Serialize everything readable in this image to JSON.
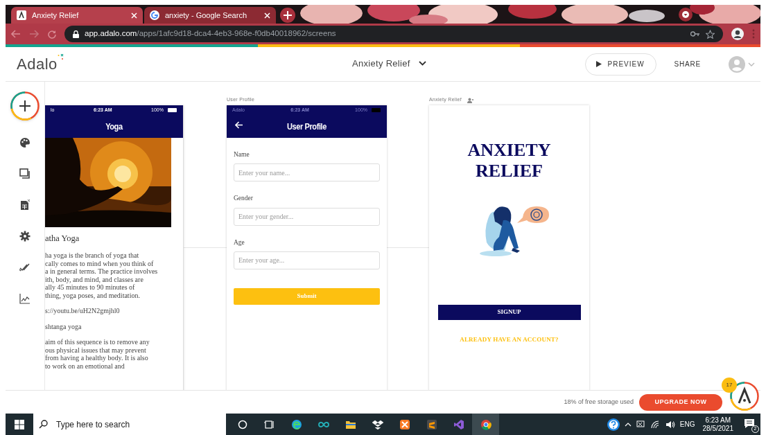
{
  "browser": {
    "tabs": [
      {
        "title": "Anxiety Relief",
        "selected": true
      },
      {
        "title": "anxiety - Google Search",
        "selected": false
      }
    ],
    "url": {
      "host": "app.adalo.com",
      "path": "/apps/1afc9d18-dca4-4eb3-968e-f0db40018962/screens"
    }
  },
  "header": {
    "logo": "Adalo",
    "app_name": "Anxiety Relief",
    "preview": "PREVIEW",
    "share": "SHARE"
  },
  "screens": [
    {
      "kind": "article",
      "carrier": "lo",
      "time": "6:23 AM",
      "battery": "100%",
      "title": "Yoga",
      "heading": "atha Yoga",
      "paragraphs": [
        [
          "ha yoga is the branch of yoga that",
          "cally comes to mind when you think of",
          "a in general terms. The practice involves",
          "ith, body, and mind, and classes are",
          "ally 45 minutes to 90 minutes of",
          "thing, yoga poses, and meditation."
        ],
        [
          "s://youtu.be/uH2N2gmjhl0"
        ],
        [
          "shtanga yoga"
        ],
        [
          "aim of this sequence is to remove any",
          "ous physical issues that may prevent",
          "from having a healthy body. It is also",
          "to work on an emotional and"
        ]
      ]
    },
    {
      "kind": "form",
      "label": "User Profile",
      "carrier": "Adalo",
      "time": "6:23 AM",
      "battery": "100%",
      "title": "User Profile",
      "fields": [
        {
          "label": "Name",
          "placeholder": "Enter your name..."
        },
        {
          "label": "Gender",
          "placeholder": "Enter your gender..."
        },
        {
          "label": "Age",
          "placeholder": "Enter your age..."
        }
      ],
      "button": "Submit"
    },
    {
      "kind": "welcome",
      "label": "Anxiety Relief",
      "title": "ANXIETY RELIEF",
      "button": "SIGNUP",
      "link": "ALREADY HAVE AN ACCOUNT?"
    }
  ],
  "footer": {
    "storage": "18% of free storage used",
    "upgrade": "UPGRADE NOW",
    "badge": "17"
  },
  "taskbar": {
    "search_placeholder": "Type here to search",
    "language": "ENG",
    "time": "6:23 AM",
    "date": "28/5/2021",
    "notifications": "2"
  }
}
